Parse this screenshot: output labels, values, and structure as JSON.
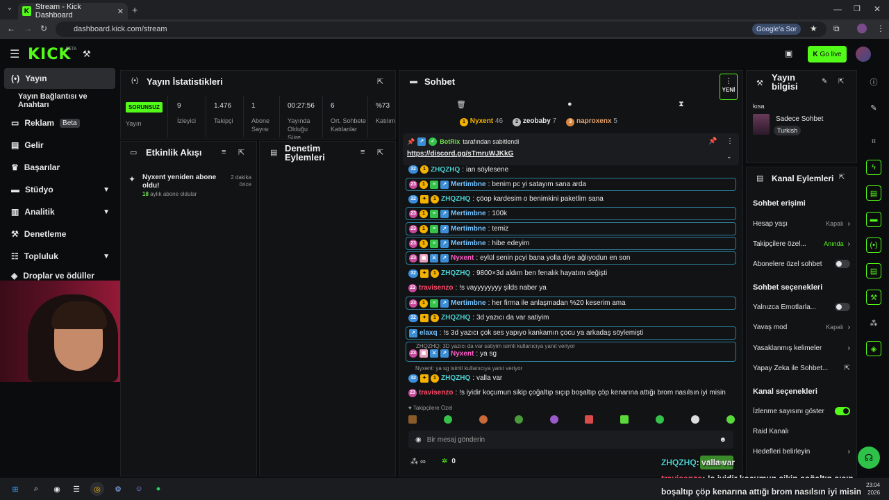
{
  "browser": {
    "tab_title": "Stream - Kick Dashboard",
    "url": "dashboard.kick.com/stream",
    "google_btn": "Google'a Sor"
  },
  "header": {
    "logo": "KICK",
    "beta": "BETA",
    "go_live": "Go live"
  },
  "sidebar": {
    "items": [
      {
        "label": "Yayın"
      },
      {
        "label": "Yayın Bağlantısı ve Anahtarı"
      },
      {
        "label": "Reklam",
        "badge": "Beta"
      },
      {
        "label": "Gelir"
      },
      {
        "label": "Başarılar"
      },
      {
        "label": "Stüdyo"
      },
      {
        "label": "Analitik"
      },
      {
        "label": "Denetleme"
      },
      {
        "label": "Topluluk"
      },
      {
        "label": "Droplar ve ödüller"
      }
    ]
  },
  "stats": {
    "title": "Yayın İstatistikleri",
    "status": "SORUNSUZ",
    "status_label": "Yayın",
    "items": [
      {
        "value": "9",
        "label": "İzleyici"
      },
      {
        "value": "1.476",
        "label": "Takipçi"
      },
      {
        "value": "1",
        "label": "Abone Sayısı"
      },
      {
        "value": "00:27:56",
        "label": "Yayında Olduğu Süre"
      },
      {
        "value": "6",
        "label": "Ort. Sohbete Katılanlar"
      },
      {
        "value": "%73",
        "label": "Katılım"
      }
    ]
  },
  "activity": {
    "title": "Etkinlik Akışı",
    "event_text": "Nyxent yeniden abone oldu!",
    "event_time": "2 dakika önce",
    "event_count": "18",
    "event_sub": "aylık abone oldular"
  },
  "moderation": {
    "title": "Denetim Eylemleri"
  },
  "chat": {
    "title": "Sohbet",
    "new_label": "YENİ",
    "leaders": [
      {
        "name": "Nyxent",
        "count": "46"
      },
      {
        "name": "zeobaby",
        "count": "7"
      },
      {
        "name": "naproxenx",
        "count": "5"
      }
    ],
    "pinned_by": "BotRix",
    "pinned_suffix": "tarafından sabitlendi",
    "pinned_link": "https://discord.gg/sTmruWJKkG",
    "messages": [
      {
        "user": "ZHQZHQ",
        "text": "ian söylesene",
        "style": "u-cyan"
      },
      {
        "user": "Mertimbne",
        "text": "benim pc yi satayım sana arda",
        "style": "u-blue"
      },
      {
        "user": "ZHQZHQ",
        "text": "çöop kardesim o benimkini paketlim sana",
        "style": "u-cyan"
      },
      {
        "user": "Mertimbne",
        "text": "100k",
        "style": "u-blue"
      },
      {
        "user": "Mertimbne",
        "text": "temiz",
        "style": "u-blue"
      },
      {
        "user": "Mertimbne",
        "text": "hibe edeyim",
        "style": "u-blue"
      },
      {
        "user": "Nyxent",
        "text": "eylül senin pcyi bana yolla diye ağlıyodun en son",
        "style": "u-pink"
      },
      {
        "user": "ZHQZHQ",
        "text": "9800×3d aldım ben fenalık hayatım değişti",
        "style": "u-cyan"
      },
      {
        "user": "travisenzo",
        "text": "!s vayyyyyyyy şilds naber ya",
        "style": "u-red"
      },
      {
        "user": "Mertimbne",
        "text": "her firma ile anlaşmadan %20 keserim ama",
        "style": "u-blue"
      },
      {
        "user": "ZHQZHQ",
        "text": "3d yazıcı da var satiyim",
        "style": "u-cyan"
      },
      {
        "user": "elaxq",
        "text": "!s 3d yazıcı çok ses yapıyo kankamın çocu ya arkadaş söylemişti",
        "style": "u-blue"
      },
      {
        "user": "Nyxent",
        "text": "ya sg",
        "style": "u-pink"
      },
      {
        "user": "ZHQZHQ",
        "text": "valla var",
        "style": "u-cyan"
      },
      {
        "user": "travisenzo",
        "text": "!s iyidir koçumun sikip çoğaltıp sıçıp boşaltıp çöp kenarına attığı brom nasılsın iyi misin",
        "style": "u-red"
      }
    ],
    "reply_1": "ZHQZHQ: 3D yazıcı da var satiyim isimli kullanıcıya yanıt veriyor",
    "reply_2": "Nyxent: ya sg isimli kullanıcıya yanıt veriyor",
    "followers_only": "Takipçilere Özel",
    "placeholder": "Bir mesaj gönderin",
    "footer_count": "0",
    "send_label": "Sohbet"
  },
  "stream_info": {
    "title": "Yayın bilgisi",
    "short_title": "kısa",
    "category": "Sadece Sohbet",
    "tag": "Turkish"
  },
  "channel_actions": {
    "title": "Kanal Eylemleri",
    "chat_access": "Sohbet erişimi",
    "rows": [
      {
        "label": "Hesap yaşı",
        "value": "Kapalı"
      },
      {
        "label": "Takipçilere özel...",
        "value": "Anında"
      },
      {
        "label": "Abonelere özel sohbet",
        "value": ""
      }
    ],
    "chat_options": "Sohbet seçenekleri",
    "rows2": [
      {
        "label": "Yalnızca Emotlarla...",
        "value": ""
      },
      {
        "label": "Yavaş mod",
        "value": "Kapalı"
      },
      {
        "label": "Yasaklanmış kelimeler",
        "value": ""
      },
      {
        "label": "Yapay Zeka ile Sohbet...",
        "value": ""
      }
    ],
    "channel_options": "Kanal seçenekleri",
    "rows3": [
      {
        "label": "İzlenme sayısını göster",
        "value": ""
      },
      {
        "label": "Raid Kanalı",
        "value": ""
      },
      {
        "label": "Hedefleri belirleyin",
        "value": ""
      }
    ]
  },
  "overlay": {
    "line1_user": "ZHQZHQ",
    "line1_text": ": valla var",
    "line2_user": "travisenzo",
    "line2_text": ": !s iyidir koçumun sikip çoğaltıp sıçıp",
    "line3_text": "boşaltıp çöp kenarına attığı brom nasılsın iyi misin"
  },
  "taskbar": {
    "time": "23:04",
    "date": "2026"
  },
  "colors": {
    "brand": "#53fc18",
    "bg": "#0b0c0d",
    "panel": "#121315"
  }
}
